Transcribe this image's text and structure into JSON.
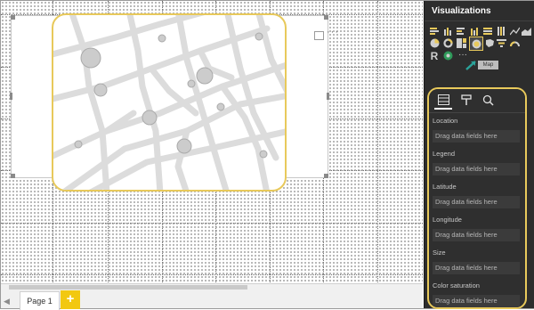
{
  "canvas": {
    "visual": {
      "more_label": "···"
    }
  },
  "pages": {
    "tab_label": "Page 1",
    "add_label": "+"
  },
  "visualizations": {
    "title": "Visualizations",
    "tooltip": "Map",
    "r_label": "R",
    "more_label": "···",
    "wells": [
      {
        "label": "Location",
        "placeholder": "Drag data fields here"
      },
      {
        "label": "Legend",
        "placeholder": "Drag data fields here"
      },
      {
        "label": "Latitude",
        "placeholder": "Drag data fields here"
      },
      {
        "label": "Longitude",
        "placeholder": "Drag data fields here"
      },
      {
        "label": "Size",
        "placeholder": "Drag data fields here"
      },
      {
        "label": "Color saturation",
        "placeholder": "Drag data fields here"
      }
    ]
  },
  "colors": {
    "accent": "#e8c95b",
    "add_page": "#f2c811",
    "panel": "#2d2d2d"
  }
}
